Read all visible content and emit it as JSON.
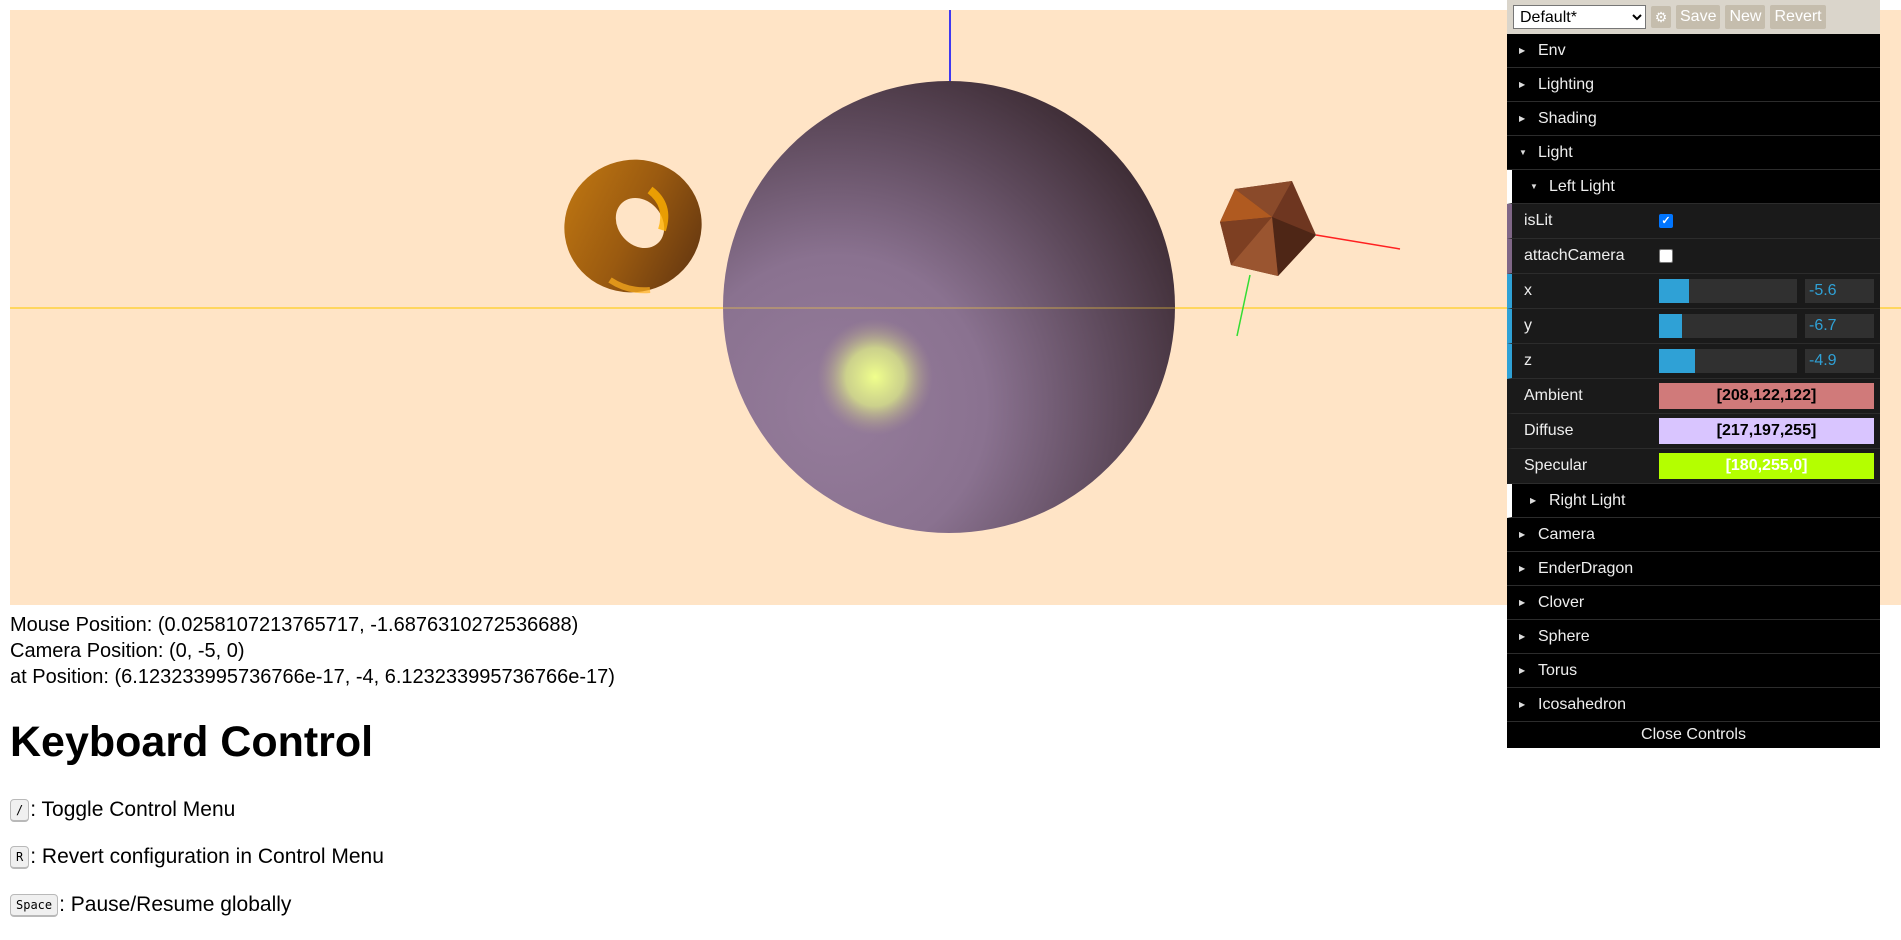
{
  "scene": {
    "background": "#ffe4c6",
    "sphere_color": "#8a7692",
    "highlight_color": "#e9f58a",
    "torus_color": "#b36a10",
    "icosahedron_color": "#6b321d"
  },
  "info": {
    "mouse": "Mouse Position: (0.0258107213765717, -1.6876310272536688)",
    "camera": "Camera Position: (0, -5, 0)",
    "at": "at Position: (6.123233995736766e-17, -4, 6.123233995736766e-17)"
  },
  "keyboard": {
    "title": "Keyboard Control",
    "rows": [
      {
        "key": "/",
        "text": ": Toggle Control Menu"
      },
      {
        "key": "R",
        "text": ": Revert configuration in Control Menu"
      },
      {
        "key": "Space",
        "text": ": Pause/Resume globally"
      }
    ]
  },
  "gui": {
    "preset": "Default*",
    "gear_icon": "gear-icon",
    "save": "Save",
    "new": "New",
    "revert": "Revert",
    "folders_top": [
      "Env",
      "Lighting",
      "Shading",
      "Light"
    ],
    "left_light": {
      "title": "Left Light",
      "isLit": {
        "label": "isLit",
        "checked": true
      },
      "attachCamera": {
        "label": "attachCamera",
        "checked": false
      },
      "x": {
        "label": "x",
        "value": "-5.6",
        "fraction": 0.22
      },
      "y": {
        "label": "y",
        "value": "-6.7",
        "fraction": 0.17
      },
      "z": {
        "label": "z",
        "value": "-4.9",
        "fraction": 0.26
      },
      "ambient": {
        "label": "Ambient",
        "value": "[208,122,122]",
        "color": "#d07a7a",
        "text_color": "#000000"
      },
      "diffuse": {
        "label": "Diffuse",
        "value": "[217,197,255]",
        "color": "#d9c5ff",
        "text_color": "#000000"
      },
      "specular": {
        "label": "Specular",
        "value": "[180,255,0]",
        "color": "#b4ff00",
        "text_color": "#ffffff"
      }
    },
    "right_light": "Right Light",
    "folders_bottom": [
      "Camera",
      "EnderDragon",
      "Clover",
      "Sphere",
      "Torus",
      "Icosahedron"
    ],
    "close": "Close Controls"
  }
}
